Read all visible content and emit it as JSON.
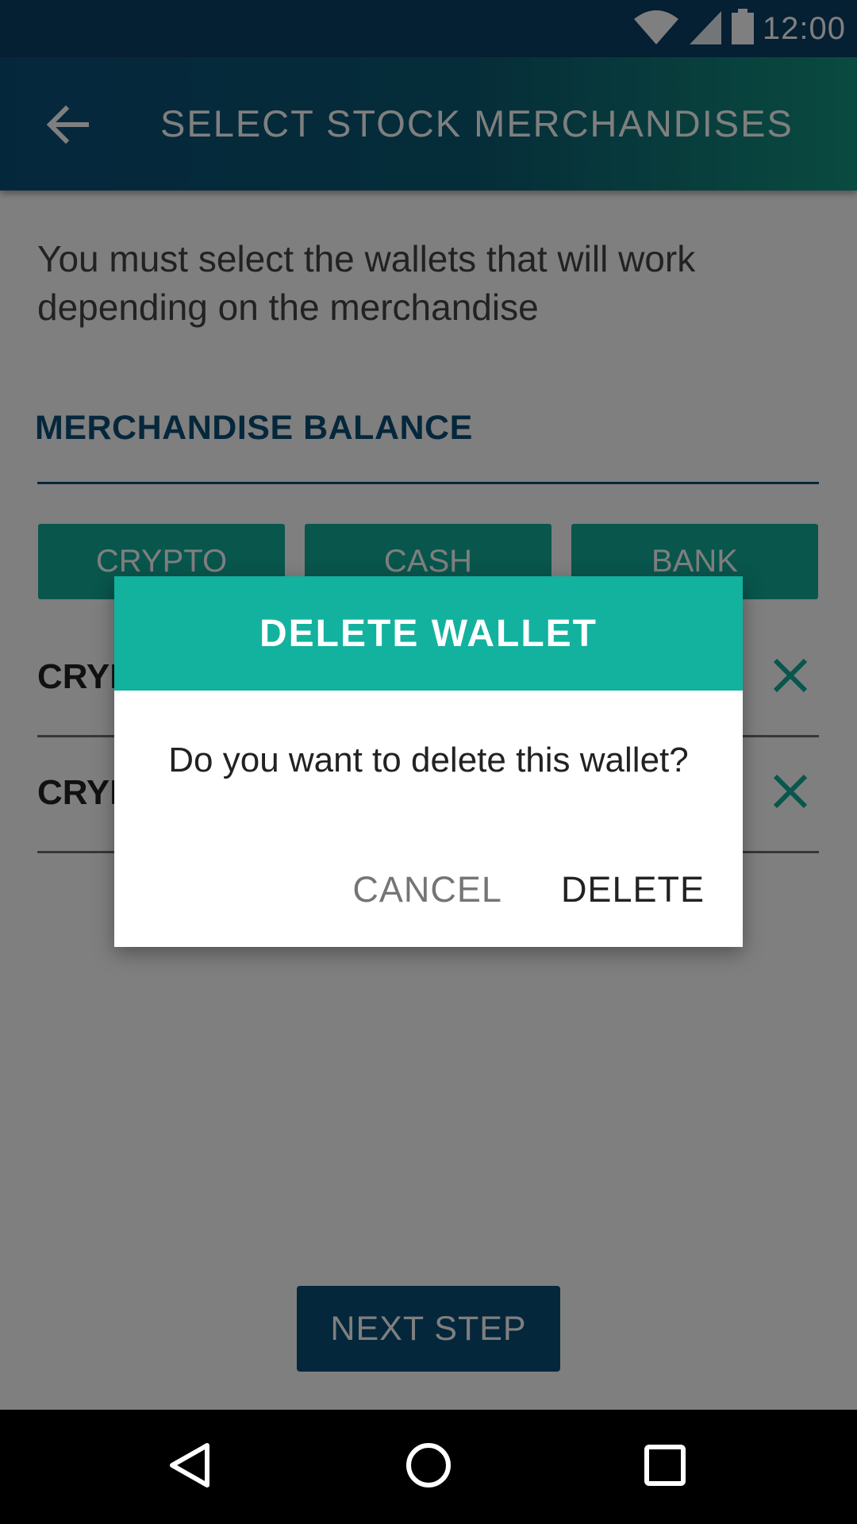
{
  "status_bar": {
    "time": "12:00",
    "icons": [
      "wifi-icon",
      "signal-icon",
      "battery-icon"
    ]
  },
  "app_bar": {
    "back_icon": "arrow-left-icon",
    "title": "SELECT STOCK MERCHANDISES"
  },
  "content": {
    "intro": "You must select the wallets that will work depending on the merchandise",
    "section_title": "MERCHANDISE BALANCE",
    "tabs": [
      "CRYPTO",
      "CASH",
      "BANK"
    ],
    "wallets": [
      {
        "name": "CRYP",
        "remove_icon": "close-icon"
      },
      {
        "name": "CRYP",
        "remove_icon": "close-icon"
      }
    ],
    "next_button": "NEXT STEP"
  },
  "dialog": {
    "title": "DELETE WALLET",
    "message": "Do you want to delete this wallet?",
    "cancel_label": "CANCEL",
    "delete_label": "DELETE"
  },
  "nav_bar": {
    "icons": [
      "nav-back-icon",
      "nav-home-icon",
      "nav-recents-icon"
    ]
  },
  "colors": {
    "primary": "#0b4f79",
    "accent": "#12b29f",
    "gradient_end": "#14957f"
  }
}
